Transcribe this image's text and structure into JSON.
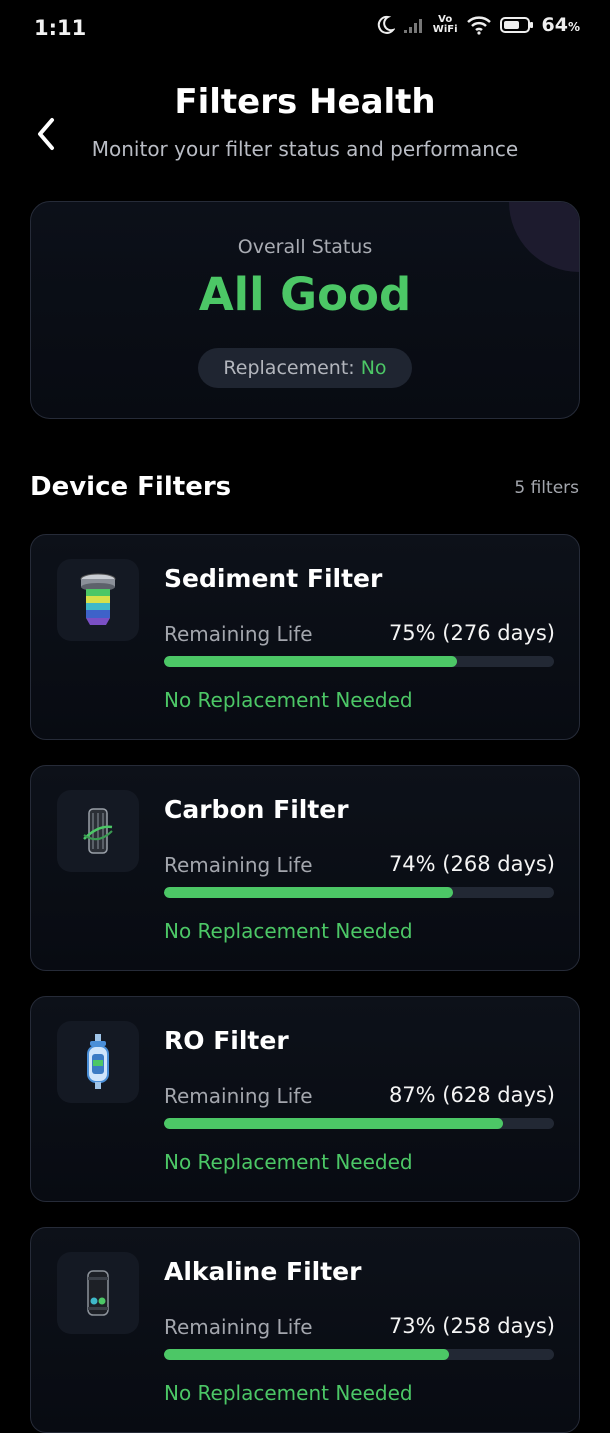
{
  "status_bar": {
    "time": "1:11",
    "vowifi_top": "Vo",
    "vowifi_bottom": "WiFi",
    "battery": "64",
    "battery_unit": "%"
  },
  "header": {
    "title": "Filters Health",
    "subtitle": "Monitor your filter status and performance"
  },
  "overall": {
    "label": "Overall Status",
    "value": "All Good",
    "replacement_label": "Replacement: ",
    "replacement_value": "No"
  },
  "section": {
    "title": "Device Filters",
    "count": "5 filters"
  },
  "colors": {
    "accent_green": "#4cc766",
    "background": "#000000",
    "card_border": "#262b38"
  },
  "filters": [
    {
      "name": "Sediment Filter",
      "remaining_label": "Remaining Life",
      "remaining_value": "75% (276 days)",
      "percent": 75,
      "state": "No Replacement Needed",
      "icon": "sediment-filter-icon"
    },
    {
      "name": "Carbon Filter",
      "remaining_label": "Remaining Life",
      "remaining_value": "74% (268 days)",
      "percent": 74,
      "state": "No Replacement Needed",
      "icon": "carbon-filter-icon"
    },
    {
      "name": "RO Filter",
      "remaining_label": "Remaining Life",
      "remaining_value": "87% (628 days)",
      "percent": 87,
      "state": "No Replacement Needed",
      "icon": "ro-filter-icon"
    },
    {
      "name": "Alkaline Filter",
      "remaining_label": "Remaining Life",
      "remaining_value": "73% (258 days)",
      "percent": 73,
      "state": "No Replacement Needed",
      "icon": "alkaline-filter-icon"
    }
  ]
}
